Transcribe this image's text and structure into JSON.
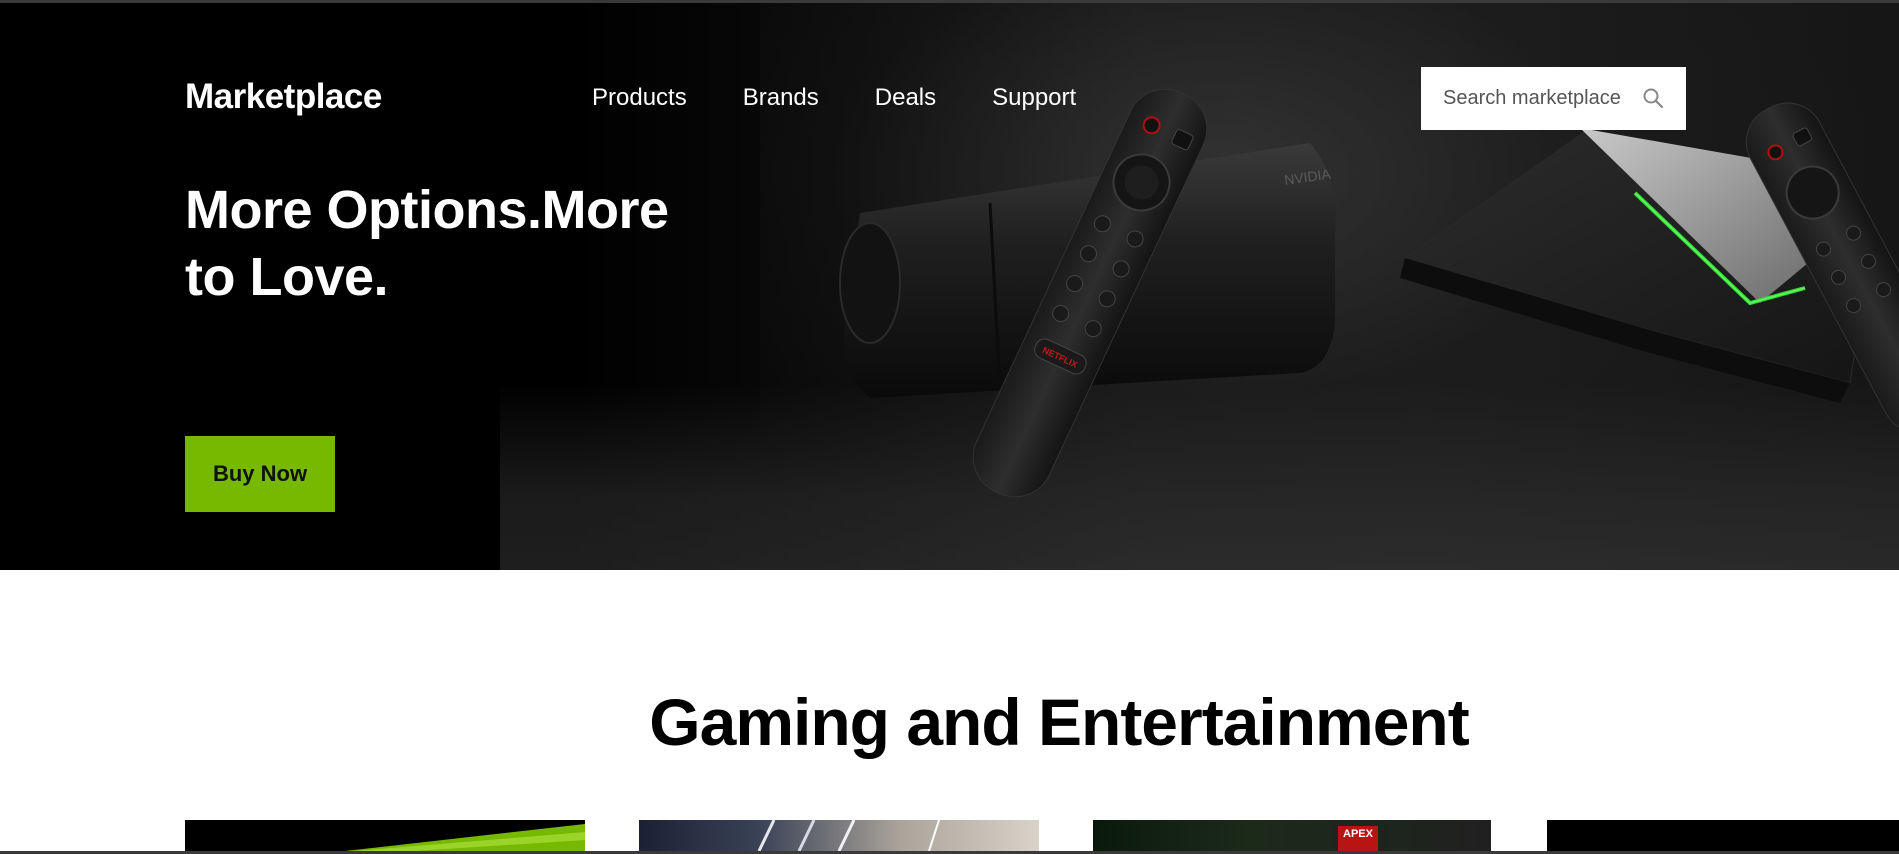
{
  "header": {
    "logo": "Marketplace",
    "nav": [
      {
        "label": "Products"
      },
      {
        "label": "Brands"
      },
      {
        "label": "Deals"
      },
      {
        "label": "Support"
      }
    ],
    "search": {
      "placeholder": "Search marketplace",
      "icon": "search-icon"
    }
  },
  "hero": {
    "title": "More Options.More to Love.",
    "cta_label": "Buy Now",
    "accent_color": "#76b900",
    "remote_button_text": "NETFLIX",
    "device_brand_text": "NVIDIA"
  },
  "section": {
    "title": "Gaming and Entertainment",
    "cards": [
      {
        "name": "card-1"
      },
      {
        "name": "card-2"
      },
      {
        "name": "card-3",
        "badge": "APEX"
      },
      {
        "name": "card-4"
      }
    ]
  }
}
